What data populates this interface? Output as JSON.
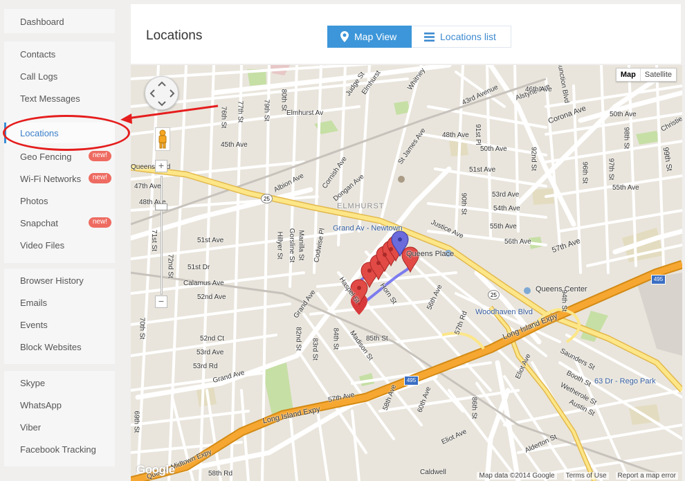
{
  "sidebar": {
    "group1": [
      {
        "label": "Dashboard"
      }
    ],
    "group2": [
      {
        "label": "Contacts"
      },
      {
        "label": "Call Logs"
      },
      {
        "label": "Text Messages"
      },
      {
        "label": "Locations",
        "active": true
      },
      {
        "label": "Geo Fencing",
        "badge": "new!"
      },
      {
        "label": "Wi-Fi Networks",
        "badge": "new!"
      },
      {
        "label": "Photos"
      },
      {
        "label": "Snapchat",
        "badge": "new!"
      },
      {
        "label": "Video Files"
      }
    ],
    "group3": [
      {
        "label": "Browser History"
      },
      {
        "label": "Emails"
      },
      {
        "label": "Events"
      },
      {
        "label": "Block Websites"
      }
    ],
    "group4": [
      {
        "label": "Skype"
      },
      {
        "label": "WhatsApp"
      },
      {
        "label": "Viber"
      },
      {
        "label": "Facebook Tracking"
      }
    ]
  },
  "header": {
    "title": "Locations",
    "map_view_label": "Map View",
    "list_label": "Locations list"
  },
  "map": {
    "type_map": "Map",
    "type_satellite": "Satellite",
    "zoom_in": "+",
    "zoom_out": "−",
    "logo": "Google",
    "footer": {
      "data": "Map data ©2014 Google",
      "terms": "Terms of Use",
      "report": "Report a map error"
    },
    "labels": [
      {
        "t": "Elmhurst Av",
        "cls": "big blue"
      },
      {
        "t": "45th Ave"
      },
      {
        "t": "Queens Blvd",
        "cls": "big"
      },
      {
        "t": "47th Ave"
      },
      {
        "t": "48th Ave"
      },
      {
        "t": "51st Ave",
        "cls": "big"
      },
      {
        "t": "ELMHURST",
        "cls": "gray"
      },
      {
        "t": "Grand Av - Newtown",
        "cls": "big blue"
      },
      {
        "t": "Justice Ave"
      },
      {
        "t": "Queens Place",
        "cls": "big"
      },
      {
        "t": "Queens Center",
        "cls": "big"
      },
      {
        "t": "Woodhaven Blvd",
        "cls": "big blue"
      },
      {
        "t": "Long Island Expy",
        "cls": "big"
      },
      {
        "t": "Long Island Expy",
        "cls": "big"
      },
      {
        "t": "57th Ave"
      },
      {
        "t": "57th Ave",
        "cls": "big"
      },
      {
        "t": "Grand Ave"
      },
      {
        "t": "Grand Ave"
      },
      {
        "t": "Corona Ave",
        "cls": "big"
      },
      {
        "t": "63 Dr - Rego Park",
        "cls": "big blue"
      },
      {
        "t": "Queens Midtown Expy"
      },
      {
        "t": "Calamus Ave"
      },
      {
        "t": "52nd Ave"
      },
      {
        "t": "Albion Ave"
      },
      {
        "t": "Dongan Ave"
      },
      {
        "t": "Cornish Ave"
      },
      {
        "t": "St James Ave"
      },
      {
        "t": "48th Ave"
      },
      {
        "t": "50th Ave"
      },
      {
        "t": "51st Ave"
      },
      {
        "t": "53rd Ave"
      },
      {
        "t": "54th Ave"
      },
      {
        "t": "55th Ave"
      },
      {
        "t": "56th Ave"
      },
      {
        "t": "Saunders St"
      },
      {
        "t": "Booth St"
      },
      {
        "t": "Wetherole St"
      },
      {
        "t": "Austin St"
      },
      {
        "t": "Eliot Ave"
      },
      {
        "t": "Eliot Ave"
      },
      {
        "t": "Alstyne Ave"
      },
      {
        "t": "46th Ave"
      },
      {
        "t": "50th Ave"
      },
      {
        "t": "55th Ave"
      },
      {
        "t": "Haspel St"
      },
      {
        "t": "Horn St"
      },
      {
        "t": "85th St"
      },
      {
        "t": "Madison St"
      },
      {
        "t": "57th Rd"
      },
      {
        "t": "56th Ave"
      },
      {
        "t": "58th Ave"
      },
      {
        "t": "60th Ave"
      },
      {
        "t": "Alderton St"
      },
      {
        "t": "Caldwell"
      },
      {
        "t": "58th Rd"
      },
      {
        "t": "Judge St"
      },
      {
        "t": "Elmhurst"
      },
      {
        "t": "Whitney"
      },
      {
        "t": "43rd Avenue"
      },
      {
        "t": "51st Dr"
      },
      {
        "t": "52nd Ct"
      },
      {
        "t": "53rd Rd"
      },
      {
        "t": "53rd Ave"
      },
      {
        "t": "72nd St"
      },
      {
        "t": "71st St"
      },
      {
        "t": "70th St"
      },
      {
        "t": "76th St"
      },
      {
        "t": "77th St"
      },
      {
        "t": "79th St"
      },
      {
        "t": "80th St"
      },
      {
        "t": "82nd St"
      },
      {
        "t": "83rd St"
      },
      {
        "t": "84th St"
      },
      {
        "t": "86th St"
      },
      {
        "t": "90th St"
      },
      {
        "t": "91st Pl"
      },
      {
        "t": "92nd St"
      },
      {
        "t": "94th St"
      },
      {
        "t": "96th St"
      },
      {
        "t": "97th St"
      },
      {
        "t": "98th St"
      },
      {
        "t": "99th St"
      },
      {
        "t": "Hillyer St"
      },
      {
        "t": "Gorsline St"
      },
      {
        "t": "Manilla St"
      },
      {
        "t": "Codwise Pl"
      },
      {
        "t": "Christie"
      },
      {
        "t": "69th St"
      },
      {
        "t": "Junction Blvd"
      }
    ],
    "highway_shields": [
      "25",
      "25",
      "495",
      "495",
      "495"
    ]
  }
}
